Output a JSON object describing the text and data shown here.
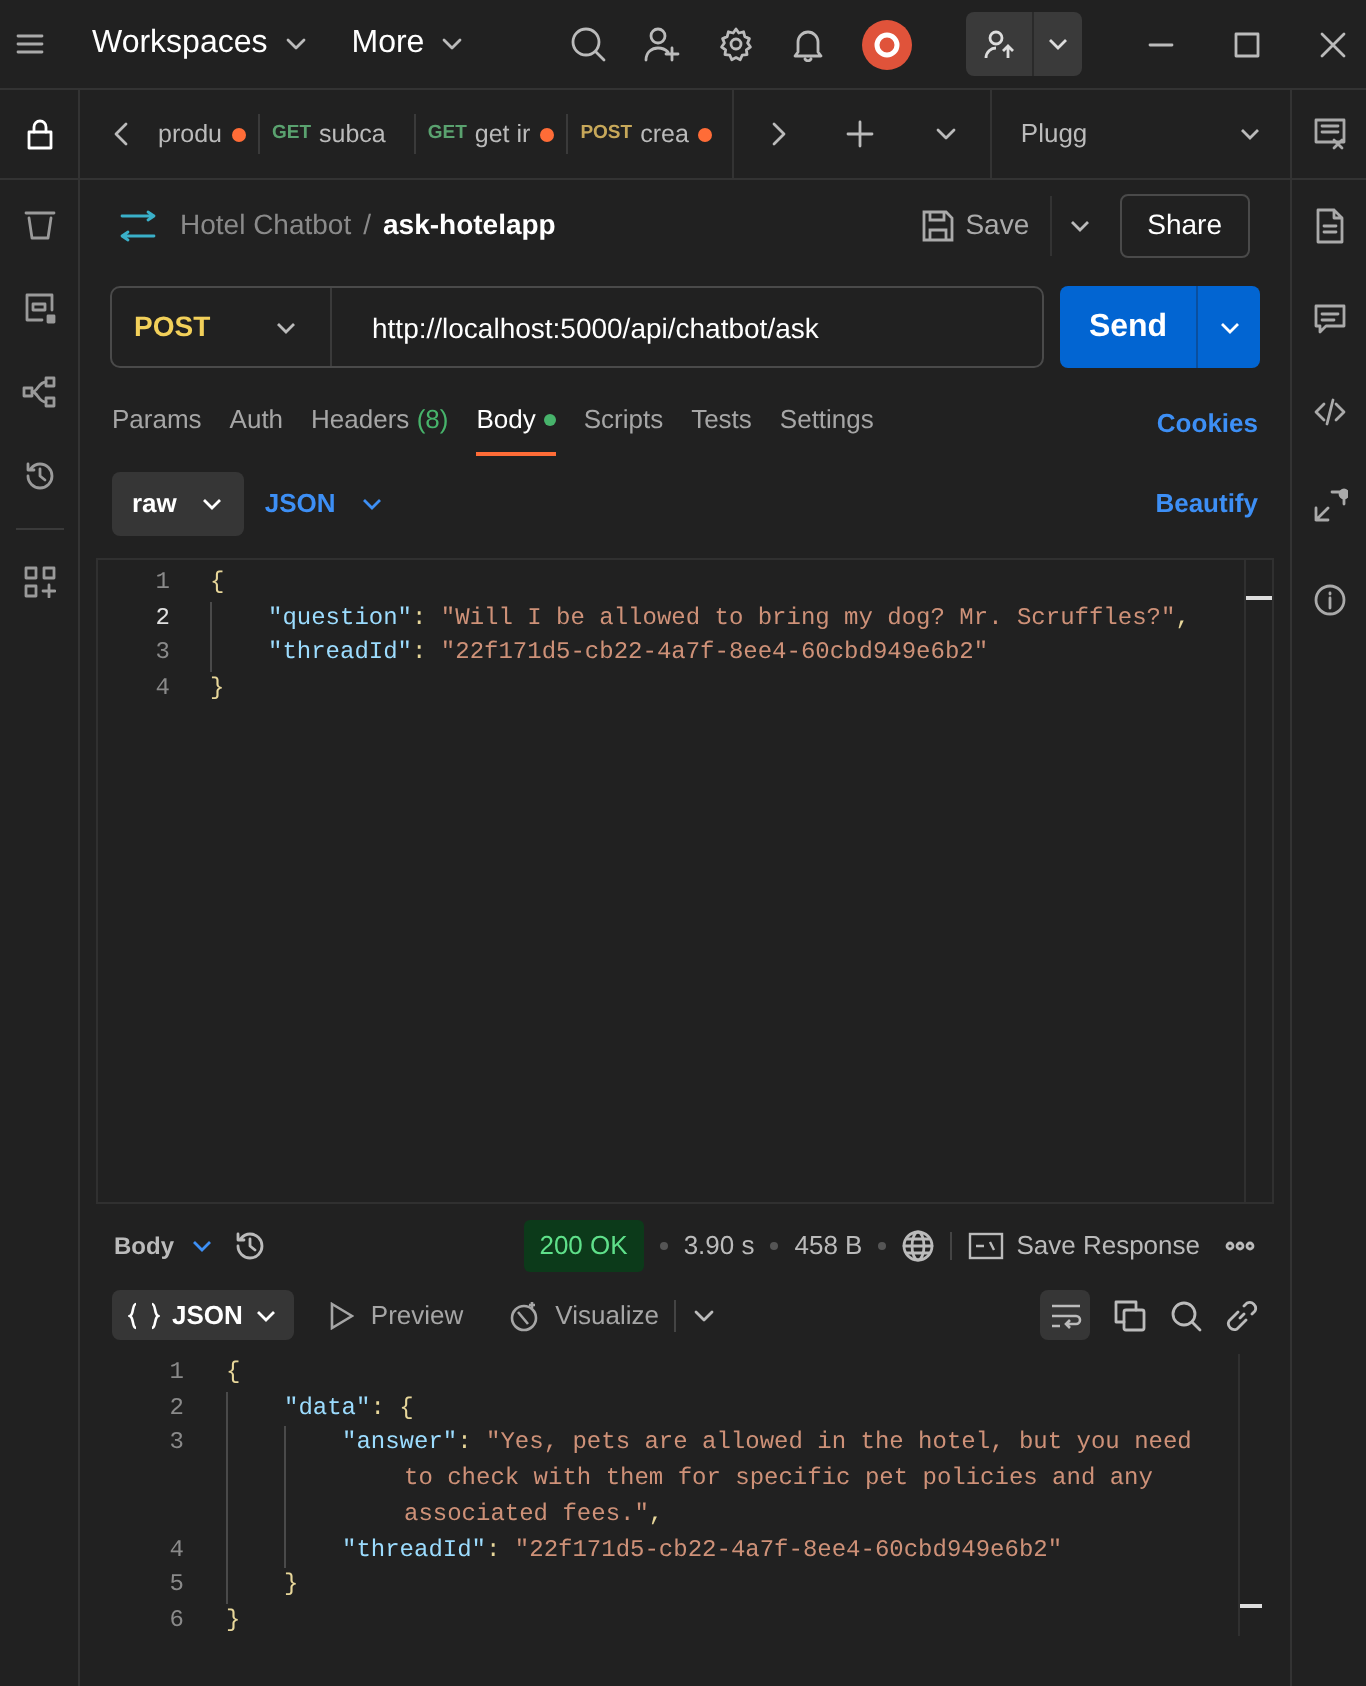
{
  "title_bar": {
    "menus": [
      {
        "label": "Workspaces"
      },
      {
        "label": "More"
      }
    ]
  },
  "tab_bar": {
    "tabs": [
      {
        "name": "produ",
        "unsaved": true
      },
      {
        "method": "GET",
        "name": "subca",
        "unsaved": false
      },
      {
        "method": "GET",
        "name": "get ir",
        "unsaved": true
      },
      {
        "method": "POST",
        "name": "crea",
        "unsaved": true
      }
    ],
    "environment": "Plugg"
  },
  "request": {
    "breadcrumb": {
      "collection": "Hotel Chatbot",
      "separator": "/",
      "name": "ask-hotelapp"
    },
    "save_label": "Save",
    "share_label": "Share",
    "method": "POST",
    "url": "http://localhost:5000/api/chatbot/ask",
    "send_label": "Send",
    "tabs": [
      {
        "label": "Params",
        "selected": false
      },
      {
        "label": "Auth",
        "selected": false
      },
      {
        "label": "Headers",
        "count": "(8)",
        "selected": false
      },
      {
        "label": "Body",
        "selected": true,
        "modified": true
      },
      {
        "label": "Scripts",
        "selected": false
      },
      {
        "label": "Tests",
        "selected": false
      },
      {
        "label": "Settings",
        "selected": false
      }
    ],
    "cookies_label": "Cookies",
    "body_mode": "raw",
    "body_language": "JSON",
    "beautify_label": "Beautify",
    "code": [
      {
        "number": "1",
        "current": false,
        "tokens": [
          {
            "kind": "punct",
            "text": "{"
          }
        ],
        "children": [
          {
            "number": "2",
            "current": true,
            "tokens": [
              {
                "kind": "key",
                "text": "\"question\""
              },
              {
                "kind": "punct",
                "text": ": "
              },
              {
                "kind": "string",
                "text": "\"Will I be allowed to bring my dog? Mr. Scruffles?\""
              },
              {
                "kind": "punct",
                "text": ","
              }
            ]
          },
          {
            "number": "3",
            "current": false,
            "tokens": [
              {
                "kind": "key",
                "text": "\"threadId\""
              },
              {
                "kind": "punct",
                "text": ": "
              },
              {
                "kind": "string",
                "text": "\"22f171d5-cb22-4a7f-8ee4-60cbd949e6b2\""
              }
            ]
          }
        ]
      },
      {
        "number": "4",
        "current": false,
        "tokens": [
          {
            "kind": "punct",
            "text": "}"
          }
        ]
      }
    ]
  },
  "response": {
    "view": "Body",
    "status": "200 OK",
    "time": "3.90 s",
    "size": "458 B",
    "save_label": "Save Response",
    "format": "JSON",
    "preview_label": "Preview",
    "visualize_label": "Visualize",
    "code": [
      {
        "number": "1",
        "tokens": [
          {
            "kind": "punct",
            "text": "{"
          }
        ],
        "children": [
          {
            "number": "2",
            "tokens": [
              {
                "kind": "key",
                "text": "\"data\""
              },
              {
                "kind": "punct",
                "text": ": {"
              }
            ],
            "children": [
              {
                "number": "3",
                "tokens": [
                  {
                    "kind": "key",
                    "text": "\"answer\""
                  },
                  {
                    "kind": "punct",
                    "text": ": "
                  },
                  {
                    "kind": "string",
                    "text": "\"Yes, pets are allowed in the hotel, but you need to check with them for specific pet policies and any associated fees.\""
                  },
                  {
                    "kind": "punct",
                    "text": ","
                  }
                ]
              },
              {
                "number": "4",
                "tokens": [
                  {
                    "kind": "key",
                    "text": "\"threadId\""
                  },
                  {
                    "kind": "punct",
                    "text": ": "
                  },
                  {
                    "kind": "string",
                    "text": "\"22f171d5-cb22-4a7f-8ee4-60cbd949e6b2\""
                  }
                ]
              }
            ]
          },
          {
            "number": "5",
            "tokens": [
              {
                "kind": "punct",
                "text": "}"
              }
            ]
          }
        ]
      },
      {
        "number": "6",
        "tokens": [
          {
            "kind": "punct",
            "text": "}"
          }
        ]
      }
    ]
  }
}
